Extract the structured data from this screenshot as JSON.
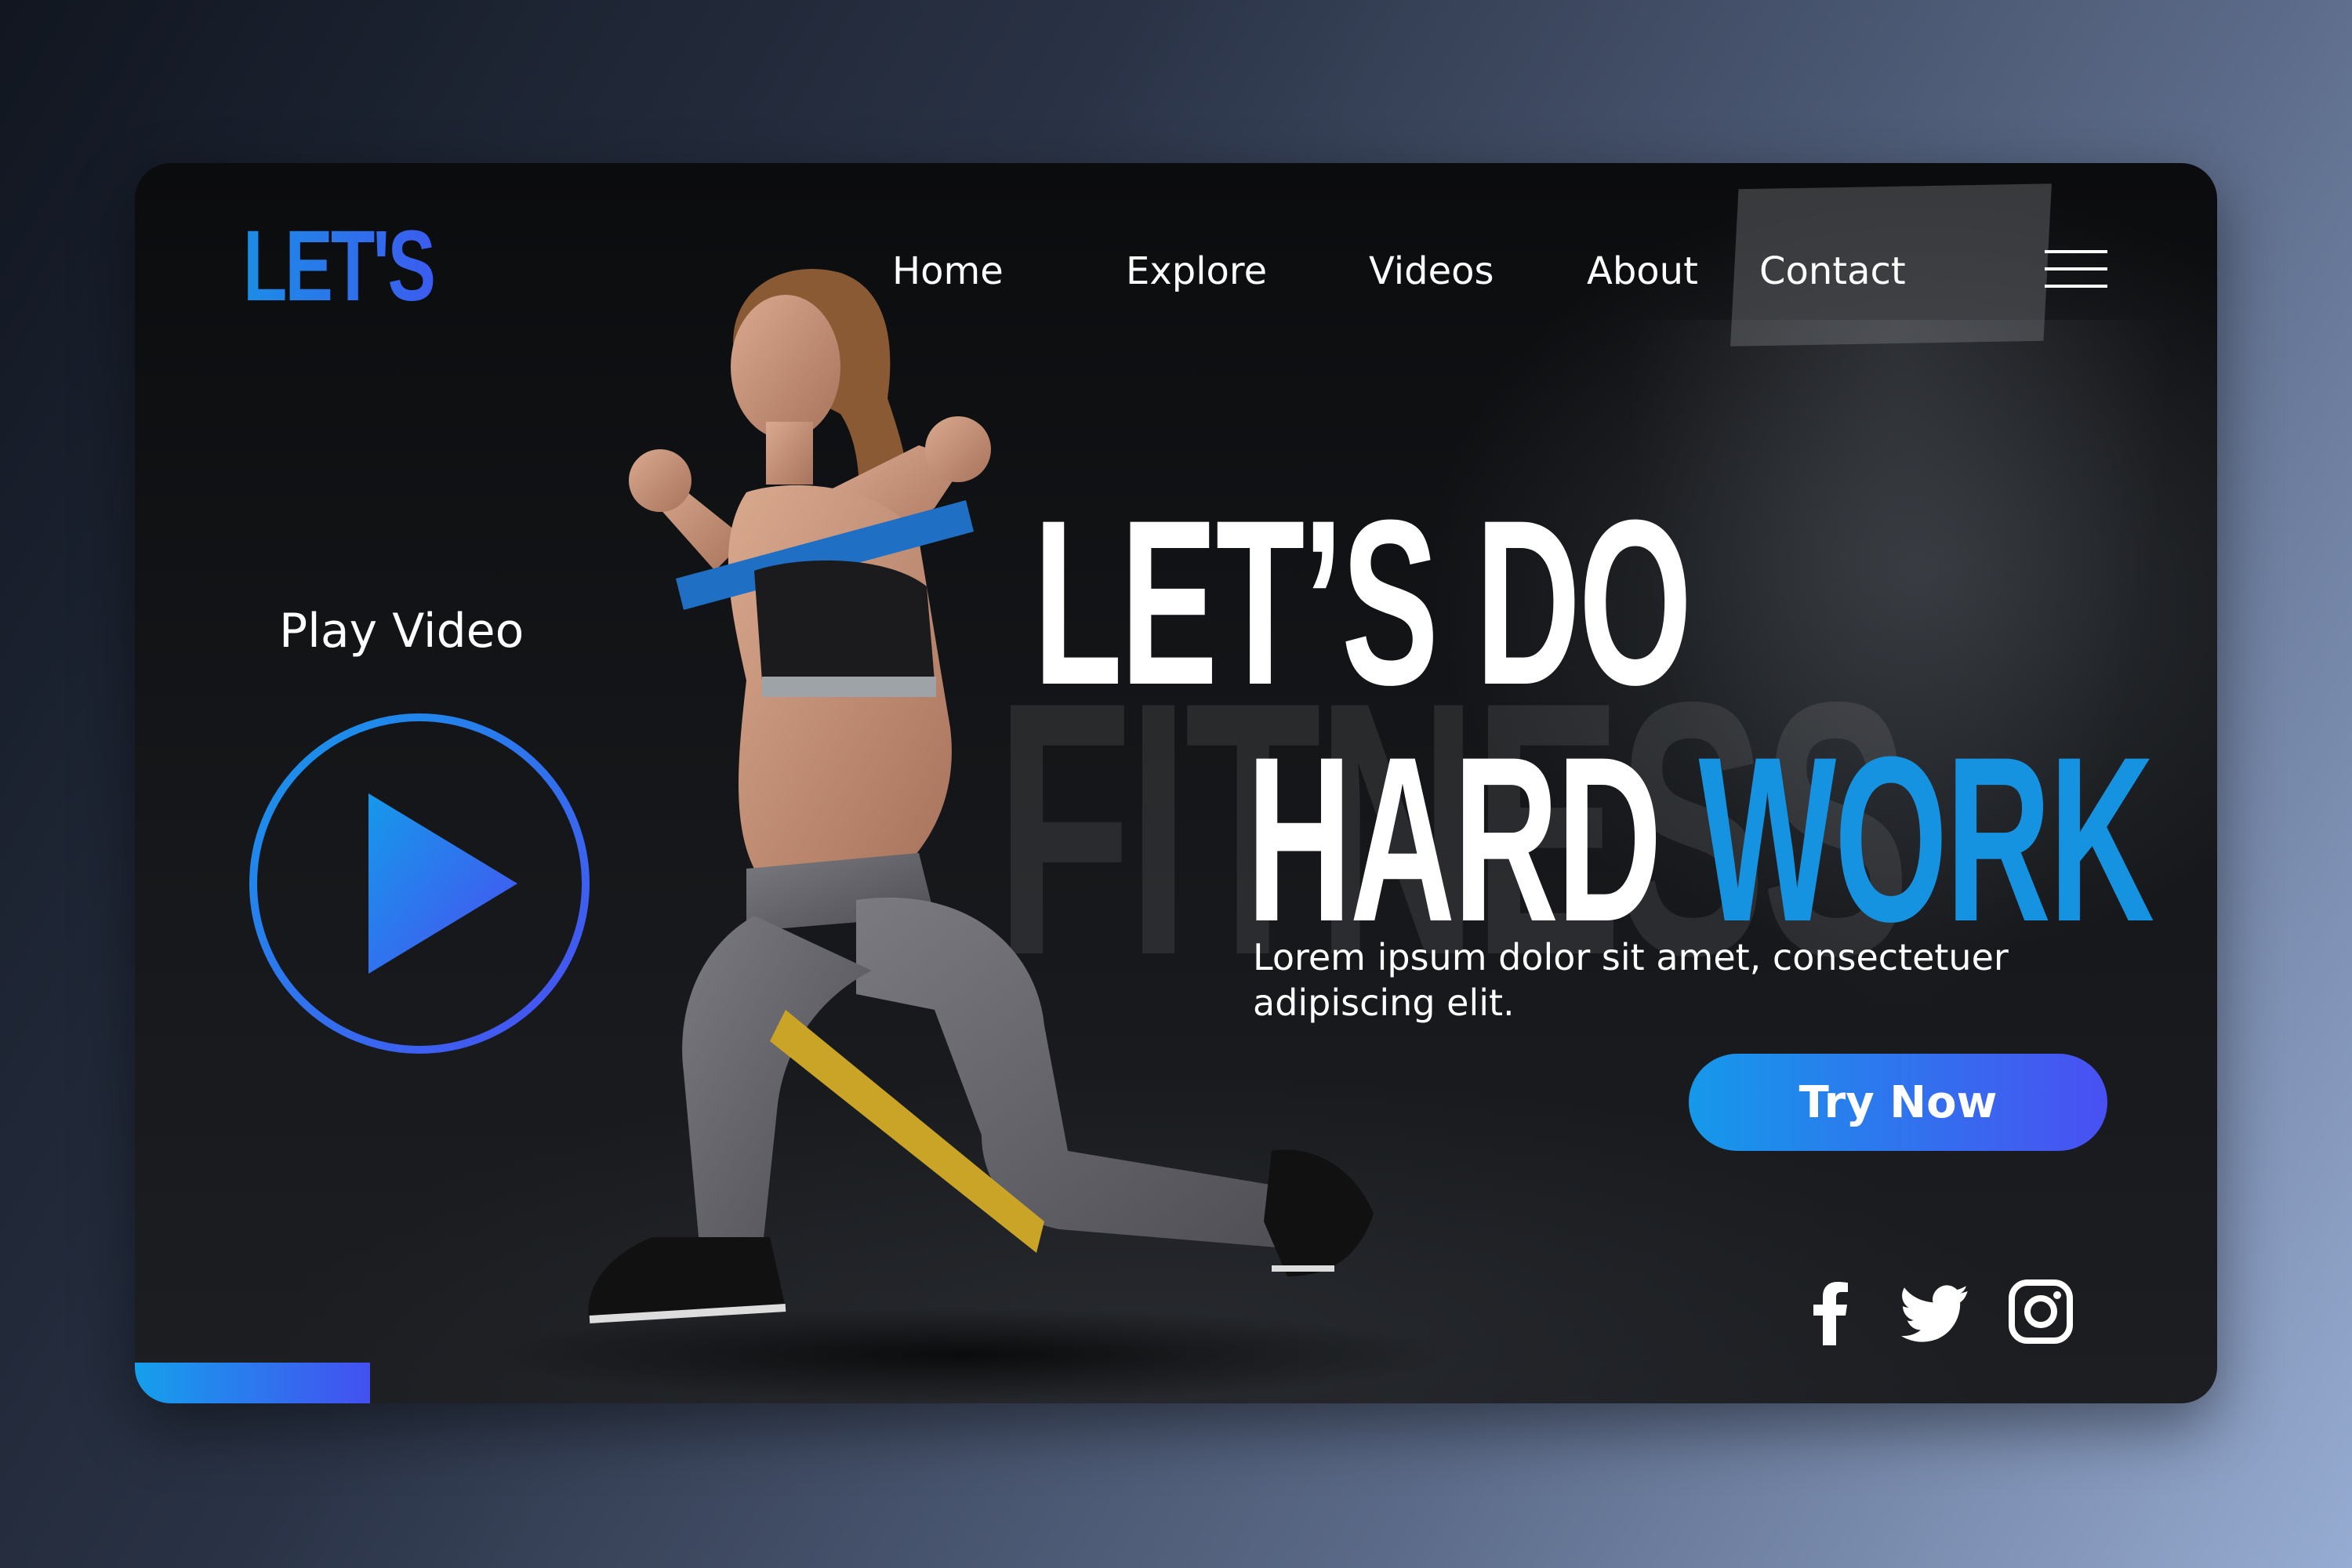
{
  "brand": {
    "logo": "LET'S"
  },
  "nav": {
    "items": [
      {
        "label": "Home"
      },
      {
        "label": "Explore"
      },
      {
        "label": "Videos"
      },
      {
        "label": "About"
      },
      {
        "label": "Contact"
      }
    ],
    "menu_icon": "hamburger-menu-icon"
  },
  "hero": {
    "background_word": "FITNESS",
    "headline_line1": "LET’S DO",
    "headline_line2_white": "HARD",
    "headline_line2_accent": "WORK",
    "subtitle": "Lorem ipsum dolor sit amet, consectetuer adipiscing elit.",
    "cta_label": "Try Now"
  },
  "video": {
    "label": "Play Video",
    "icon": "play-icon"
  },
  "social": {
    "icons": [
      "facebook-icon",
      "twitter-icon",
      "instagram-icon"
    ]
  },
  "colors": {
    "accent": "#1592e0",
    "accent_gradient_start": "#1599ea",
    "accent_gradient_end": "#4950f2",
    "card_background": "#111214"
  }
}
